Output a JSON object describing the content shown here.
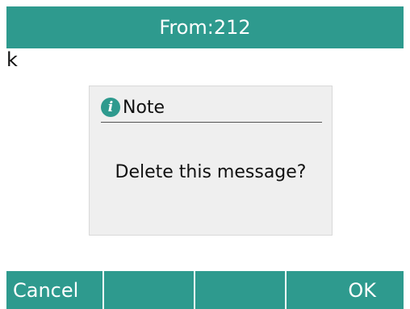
{
  "header": {
    "title": "From:212"
  },
  "message": {
    "body": "k"
  },
  "dialog": {
    "icon": "info-icon",
    "title": "Note",
    "text": "Delete this message?"
  },
  "softkeys": [
    {
      "label": "Cancel"
    },
    {
      "label": ""
    },
    {
      "label": ""
    },
    {
      "label": "OK"
    }
  ],
  "colors": {
    "accent": "#2e9a8e",
    "dialog_background": "#efefef"
  }
}
